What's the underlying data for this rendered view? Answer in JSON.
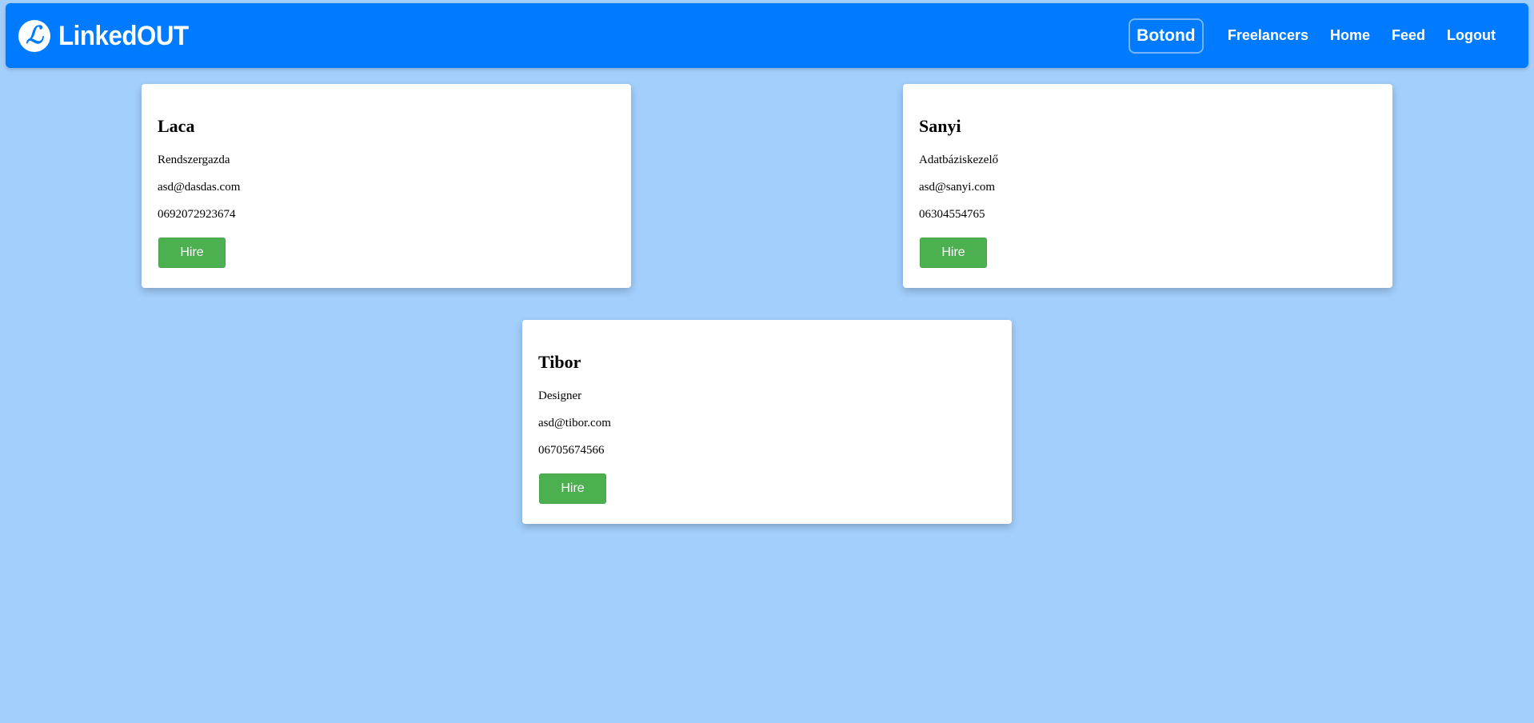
{
  "navbar": {
    "brand_logo_letter": "ℒ",
    "brand_name": "LinkedOUT",
    "user_name": "Botond",
    "links": {
      "freelancers": "Freelancers",
      "home": "Home",
      "feed": "Feed",
      "logout": "Logout"
    },
    "color": "#007bff"
  },
  "page": {
    "background_color": "#a3cffd"
  },
  "freelancers": [
    {
      "name": "Laca",
      "role": "Rendszergazda",
      "email": "asd@dasdas.com",
      "phone": "0692072923674",
      "button_label": "Hire"
    },
    {
      "name": "Sanyi",
      "role": "Adatbáziskezelő",
      "email": "asd@sanyi.com",
      "phone": "06304554765",
      "button_label": "Hire"
    },
    {
      "name": "Tibor",
      "role": "Designer",
      "email": "asd@tibor.com",
      "phone": "06705674566",
      "button_label": "Hire"
    }
  ],
  "hire_button_color": "#4caf50"
}
